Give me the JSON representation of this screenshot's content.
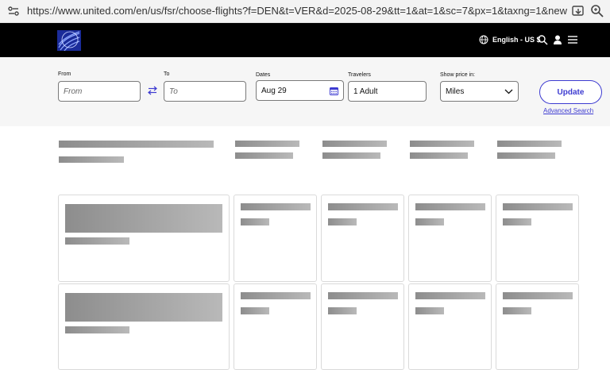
{
  "browser": {
    "url": "https://www.united.com/en/us/fsr/choose-flights?f=DEN&t=VER&d=2025-08-29&tt=1&at=1&sc=7&px=1&taxng=1&newHP=True&clm=7..."
  },
  "header": {
    "language": "English - US $"
  },
  "search": {
    "from_label": "From",
    "from_placeholder": "From",
    "to_label": "To",
    "to_placeholder": "To",
    "dates_label": "Dates",
    "dates_value": "Aug 29",
    "travelers_label": "Travelers",
    "travelers_value": "1 Adult",
    "price_label": "Show price in:",
    "price_value": "Miles",
    "update_label": "Update",
    "advanced_label": "Advanced Search"
  },
  "colors": {
    "brand_blue": "#3d3bd1",
    "header_bg": "#000000",
    "band_bg": "#f6f6f6"
  }
}
